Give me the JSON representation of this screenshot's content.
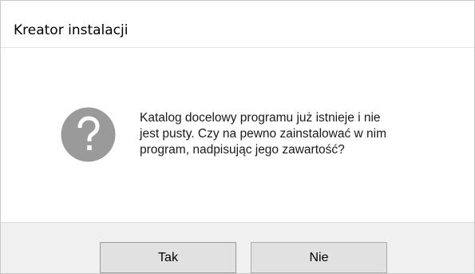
{
  "window": {
    "title": "Kreator instalacji"
  },
  "dialog": {
    "icon": "question-mark-icon",
    "message_lines": [
      "Katalog docelowy programu już istnieje i nie",
      "jest pusty. Czy na pewno zainstalować w nim",
      "program, nadpisując jego zawartość?"
    ]
  },
  "buttons": {
    "yes_label": "Tak",
    "no_label": "Nie"
  },
  "colors": {
    "icon_circle": "#9a9a9a",
    "icon_glyph": "#ffffff",
    "footer_background": "#f0f0f0",
    "button_background": "#e1e1e1"
  }
}
